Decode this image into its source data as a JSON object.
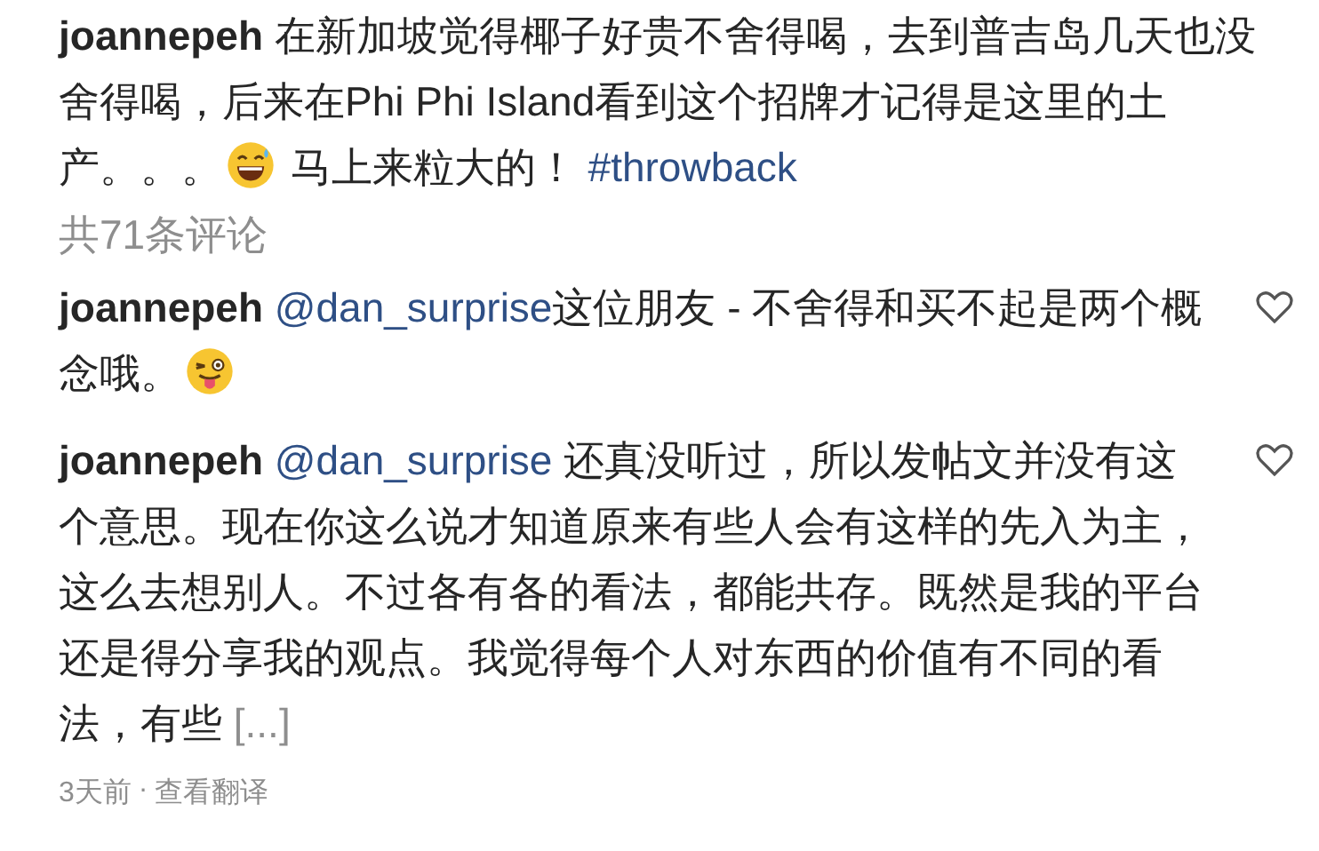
{
  "caption": {
    "username": "joannepeh",
    "segments": [
      {
        "kind": "text",
        "text": "在新加坡觉得椰子好贵不舍得喝，去到普吉岛几天也没舍得喝，后来在Phi Phi Island看到这个招牌才记得是这里的土产。。。"
      },
      {
        "kind": "laugh-emoji"
      },
      {
        "kind": "text",
        "text": "马上来粒大的！"
      },
      {
        "kind": "hashtag",
        "text": "#throwback"
      }
    ]
  },
  "comment_count": "共71条评论",
  "comments": [
    {
      "username": "joannepeh",
      "liked": false,
      "segments": [
        {
          "kind": "mention",
          "text": "@dan_surprise"
        },
        {
          "kind": "text",
          "text": "这位朋友 - 不舍得和买不起是两个概念哦。"
        },
        {
          "kind": "wink-emoji"
        }
      ]
    },
    {
      "username": "joannepeh",
      "liked": false,
      "segments": [
        {
          "kind": "mention",
          "text": "@dan_surprise"
        },
        {
          "kind": "text",
          "text": " 还真没听过，所以发帖文并没有这个意思。现在你这么说才知道原来有些人会有这样的先入为主，这么去想别人。不过各有各的看法，都能共存。既然是我的平台还是得分享我的观点。我觉得每个人对东西的价值有不同的看法，有些 "
        },
        {
          "kind": "more",
          "text": "[...]"
        }
      ]
    }
  ],
  "footer": {
    "time": "3天前",
    "separator": "·",
    "action": "查看翻译"
  }
}
